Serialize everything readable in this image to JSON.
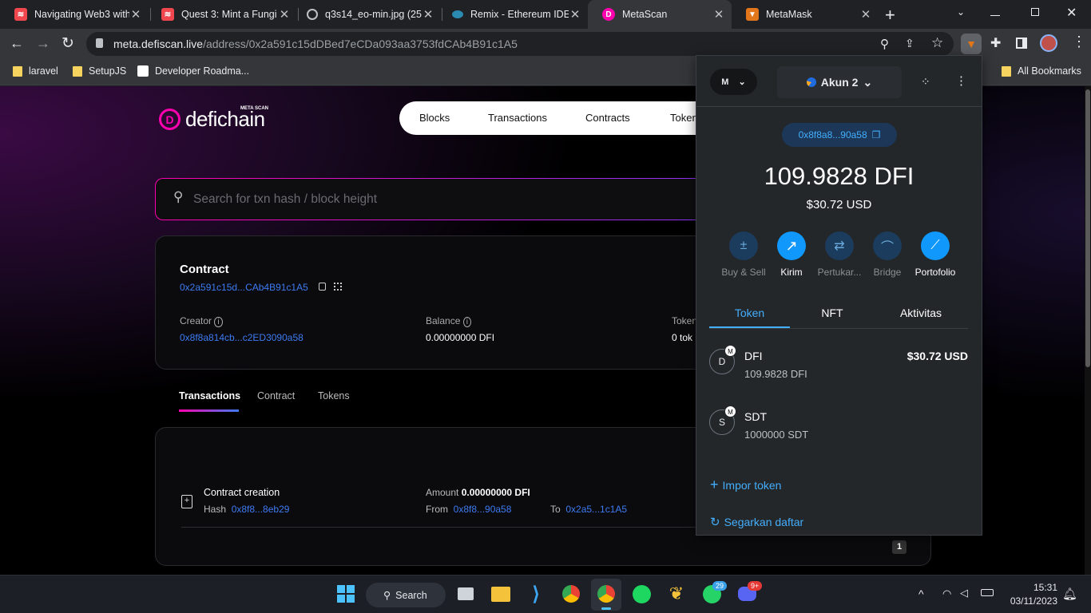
{
  "tabs": [
    {
      "title": "Navigating Web3 with",
      "favicon": "stack-logo"
    },
    {
      "title": "Quest 3: Mint a Fungi",
      "favicon": "stack-logo"
    },
    {
      "title": "q3s14_eo-min.jpg (25",
      "favicon": "globe-icon"
    },
    {
      "title": "Remix - Ethereum IDE",
      "favicon": "remix-logo"
    },
    {
      "title": "MetaScan",
      "favicon": "defichain-logo"
    },
    {
      "title": "MetaMask",
      "favicon": "metamask-fox"
    }
  ],
  "address_bar": {
    "host": "meta.defiscan.live",
    "path": "/address/0x2a591c15dDBed7eCDa093aa3753fdCAb4B91c1A5"
  },
  "bookmarks": [
    "laravel",
    "SetupJS",
    "Developer Roadma...",
    "All Bookmarks"
  ],
  "site": {
    "logo_text": "defichain",
    "logo_tag": "META SCAN",
    "nav": [
      "Blocks",
      "Transactions",
      "Contracts",
      "Token"
    ],
    "search_placeholder": "Search for txn hash / block height",
    "contract": {
      "heading": "Contract",
      "address": "0x2a591c15d...CAb4B91c1A5",
      "creator_label": "Creator",
      "creator_value": "0x8f8a814cb...c2ED3090a58",
      "balance_label": "Balance",
      "balance_value": "0.00000000 DFI",
      "tokens_label": "Token",
      "tokens_value": "0 tok"
    },
    "tabs": [
      "Transactions",
      "Contract",
      "Tokens"
    ],
    "tx": {
      "title": "Contract creation",
      "hash_label": "Hash",
      "hash": "0x8f8...8eb29",
      "amount_label": "Amount",
      "amount": "0.00000000 DFI",
      "from_label": "From",
      "from": "0x8f8...90a58",
      "to_label": "To",
      "to": "0x2a5...1c1A5"
    },
    "page_number": "1"
  },
  "metamask": {
    "network_initial": "M",
    "account_name": "Akun 2",
    "address_short": "0x8f8a8...90a58",
    "balance": "109.9828 DFI",
    "balance_usd": "$30.72 USD",
    "actions": [
      "Buy & Sell",
      "Kirim",
      "Pertukar...",
      "Bridge",
      "Portofolio"
    ],
    "tabs": [
      "Token",
      "NFT",
      "Aktivitas"
    ],
    "tokens": [
      {
        "initial": "D",
        "name": "DFI",
        "amount": "109.9828 DFI",
        "value": "$30.72 USD"
      },
      {
        "initial": "S",
        "name": "SDT",
        "amount": "1000000 SDT",
        "value": ""
      }
    ],
    "import_label": "Impor token",
    "refresh_label": "Segarkan daftar",
    "accent": "#1098fc"
  },
  "taskbar": {
    "search_label": "Search",
    "whatsapp_badge": "29",
    "discord_badge": "9+",
    "time": "15:31",
    "date": "03/11/2023"
  }
}
